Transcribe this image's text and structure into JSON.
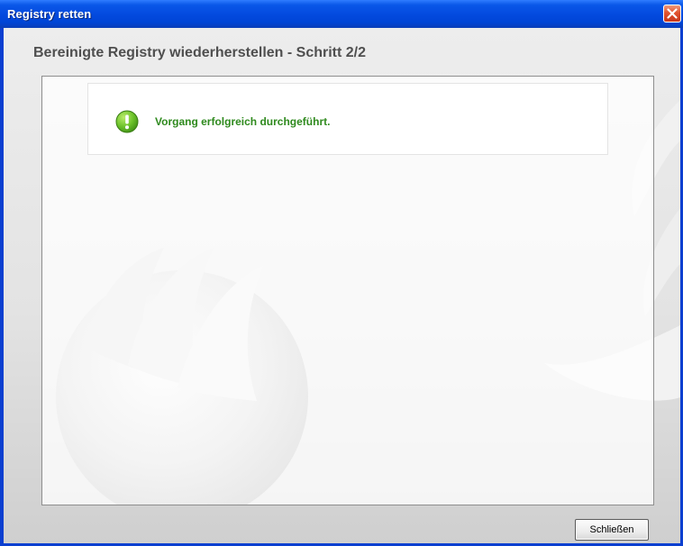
{
  "window": {
    "title": "Registry retten",
    "close_icon": "close-icon"
  },
  "wizard": {
    "step_heading": "Bereinigte Registry wiederherstellen - Schritt 2/2",
    "status": {
      "icon": "success-exclamation-icon",
      "message": "Vorgang erfolgreich durchgeführt.",
      "color": "#2f8a1e"
    },
    "close_label": "Schließen"
  },
  "colors": {
    "titlebar": "#0349de",
    "client_background": "#e3e3e3",
    "heading": "#4f4f4f",
    "success_green": "#2f8a1e"
  }
}
